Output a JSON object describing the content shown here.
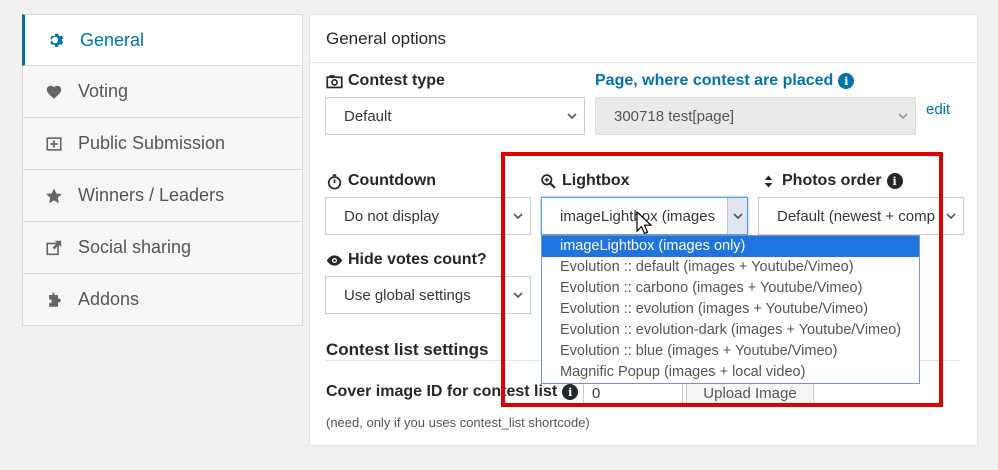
{
  "sidebar": {
    "items": [
      {
        "label": "General",
        "icon": "gear-icon",
        "active": true
      },
      {
        "label": "Voting",
        "icon": "heart-icon"
      },
      {
        "label": "Public Submission",
        "icon": "upload-icon"
      },
      {
        "label": "Winners / Leaders",
        "icon": "star-icon"
      },
      {
        "label": "Social sharing",
        "icon": "share-icon"
      },
      {
        "label": "Addons",
        "icon": "puzzle-icon"
      }
    ]
  },
  "panel": {
    "title": "General options",
    "contest_type": {
      "label": "Contest type",
      "value": "Default"
    },
    "page": {
      "label": "Page, where contest are placed",
      "value": "300718 test[page]",
      "edit_label": "edit"
    },
    "countdown": {
      "label": "Countdown",
      "value": "Do not display"
    },
    "lightbox": {
      "label": "Lightbox",
      "value": "imageLightbox (images",
      "options": [
        "imageLightbox (images only)",
        "Evolution :: default (images + Youtube/Vimeo)",
        "Evolution :: carbono (images + Youtube/Vimeo)",
        "Evolution :: evolution (images + Youtube/Vimeo)",
        "Evolution :: evolution-dark (images + Youtube/Vimeo)",
        "Evolution :: blue (images + Youtube/Vimeo)",
        "Magnific Popup (images + local video)"
      ],
      "selected_index": 0
    },
    "photos_order": {
      "label": "Photos order",
      "value": "Default (newest + comp"
    },
    "hide_votes": {
      "label": "Hide votes count?",
      "value": "Use global settings"
    },
    "list_settings": {
      "title": "Contest list settings",
      "cover_label": "Cover image ID for contest list",
      "cover_value": "0",
      "upload_label": "Upload Image",
      "hint": "(need, only if you uses contest_list shortcode)"
    }
  },
  "colors": {
    "accent": "#0073aa",
    "highlight": "#e00000",
    "selected_option": "#1e73e0"
  }
}
